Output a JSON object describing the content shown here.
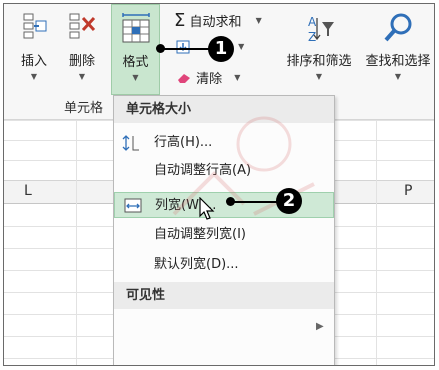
{
  "ribbon": {
    "insert_label": "插入",
    "delete_label": "删除",
    "format_label": "格式",
    "autosum_label": "自动求和",
    "clear_label": "清除",
    "sort_filter_label": "排序和筛选",
    "find_select_label": "查找和选择",
    "cells_group_label": "单元格"
  },
  "sheet": {
    "columns": [
      "L",
      "P"
    ]
  },
  "menu": {
    "section_size": "单元格大小",
    "row_height": "行高(H)...",
    "autofit_row_height": "自动调整行高(A)",
    "column_width": "列宽(W)...",
    "autofit_column_width": "自动调整列宽(I)",
    "default_width": "默认列宽(D)...",
    "section_visibility": "可见性"
  },
  "callouts": {
    "step1": "1",
    "step2": "2"
  },
  "colors": {
    "highlight_green": "#c9e6cf",
    "menu_highlight": "#cfe9d6",
    "accent_blue": "#2f6fb8",
    "delete_red": "#c0392b",
    "clear_pink": "#e0457b"
  }
}
